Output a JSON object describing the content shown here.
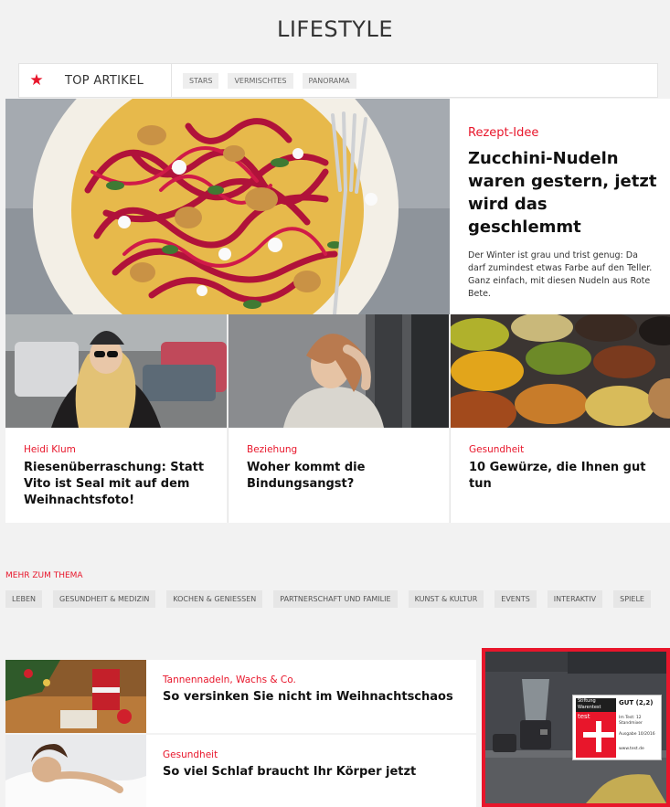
{
  "section_title": "LIFESTYLE",
  "topnav": {
    "label": "TOP ARTIKEL",
    "tabs": [
      "STARS",
      "VERMISCHTES",
      "PANORAMA"
    ]
  },
  "hero": {
    "kicker": "Rezept-Idee",
    "headline": "Zucchini-Nudeln waren gestern, jetzt wird das geschlemmt",
    "teaser": "Der Winter ist grau und trist genug: Da darf zumindest etwas Farbe auf den Teller. Ganz einfach, mit diesen Nudeln aus Rote Bete."
  },
  "cards": [
    {
      "kicker": "Heidi Klum",
      "headline": "Riesenüberraschung: Statt Vito ist Seal mit auf dem Weihnachtsfoto!"
    },
    {
      "kicker": "Beziehung",
      "headline": "Woher kommt die Bindungsangst?"
    },
    {
      "kicker": "Gesundheit",
      "headline": "10 Gewürze, die Ihnen gut tun"
    }
  ],
  "mehr": {
    "label": "MEHR ZUM THEMA",
    "tags": [
      "LEBEN",
      "GESUNDHEIT & MEDIZIN",
      "KOCHEN & GENIESSEN",
      "PARTNERSCHAFT UND FAMILIE",
      "KUNST & KULTUR",
      "EVENTS",
      "INTERAKTIV",
      "SPIELE"
    ]
  },
  "list": [
    {
      "kicker": "Tannennadeln, Wachs & Co.",
      "headline": "So versinken Sie nicht im Weihnachtschaos"
    },
    {
      "kicker": "Gesundheit",
      "headline": "So viel Schlaf braucht Ihr Körper jetzt"
    }
  ],
  "ad": {
    "seal_brand": "Stiftung Warentest",
    "seal_test": "test",
    "grade": "GUT (2,2)",
    "line1": "Im Test: 12 Standmixer",
    "line2": "Ausgabe 10/2016",
    "line3": "www.test.de"
  },
  "colors": {
    "accent": "#e8162b",
    "background": "#f2f2f2"
  }
}
